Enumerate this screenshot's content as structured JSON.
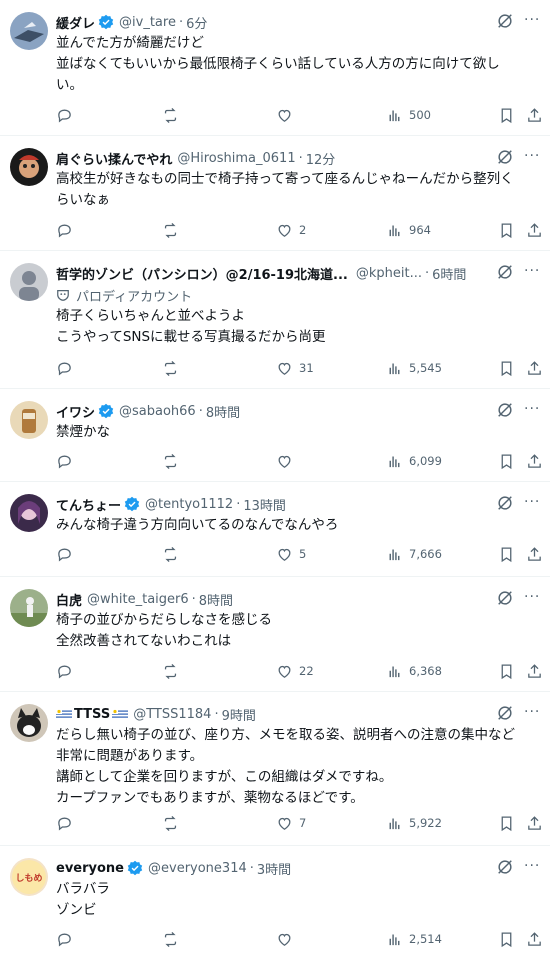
{
  "tweets": [
    {
      "name": "緩ダレ",
      "handle": "@iv_tare",
      "time": "6分",
      "verified": true,
      "lines": [
        "並んでた方が綺麗だけど",
        "並ばなくてもいいから最低限椅子くらい話している人方の方に向けて欲し",
        "い。"
      ],
      "replies": "",
      "retweets": "",
      "likes": "",
      "views": "500"
    },
    {
      "name": "肩ぐらい揉んでやれ",
      "handle": "@Hiroshima_0611",
      "time": "12分",
      "verified": false,
      "lines": [
        "高校生が好きなもの同士で椅子持って寄って座るんじゃねーんだから整列く",
        "らいなぁ"
      ],
      "replies": "",
      "retweets": "",
      "likes": "2",
      "views": "964"
    },
    {
      "name": "哲学的ゾンビ（パンシロン）@2/16-19北海道...",
      "handle": "@kpheit...",
      "time": "6時間",
      "verified": false,
      "label": "パロディアカウント",
      "lines": [
        "椅子くらいちゃんと並べようよ",
        "こうやってSNSに載せる写真撮るだから尚更"
      ],
      "replies": "",
      "retweets": "",
      "likes": "31",
      "views": "5,545"
    },
    {
      "name": "イワシ",
      "handle": "@sabaoh66",
      "time": "8時間",
      "verified": true,
      "lines": [
        "禁煙かな"
      ],
      "replies": "",
      "retweets": "",
      "likes": "",
      "views": "6,099"
    },
    {
      "name": "てんちょー",
      "handle": "@tentyo1112",
      "time": "13時間",
      "verified": true,
      "lines": [
        "みんな椅子違う方向向いてるのなんでなんやろ"
      ],
      "replies": "",
      "retweets": "",
      "likes": "5",
      "views": "7,666"
    },
    {
      "name": "白虎",
      "handle": "@white_taiger6",
      "time": "8時間",
      "verified": false,
      "lines": [
        "椅子の並びからだらしなさを感じる",
        "全然改善されてないわこれは"
      ],
      "replies": "",
      "retweets": "",
      "likes": "22",
      "views": "6,368"
    },
    {
      "name": "TTSS",
      "handle": "@TTSS1184",
      "time": "9時間",
      "verified": false,
      "lines": [
        "だらし無い椅子の並び、座り方、メモを取る姿、説明者への注意の集中など",
        "非常に問題があります。",
        "講師として企業を回りますが、この組織はダメですね。",
        "カープファンでもありますが、薬物なるほどです。"
      ],
      "replies": "",
      "retweets": "",
      "likes": "7",
      "views": "5,922"
    },
    {
      "name": "everyone",
      "handle": "@everyone314",
      "time": "3時間",
      "verified": true,
      "avatar_text": "しもめ",
      "lines": [
        "バラバラ",
        "ゾンビ"
      ],
      "replies": "",
      "retweets": "",
      "likes": "",
      "views": "2,514"
    }
  ],
  "colors": {
    "verified": "#1d9bf0",
    "text": "#0f1419",
    "muted": "#536471"
  }
}
